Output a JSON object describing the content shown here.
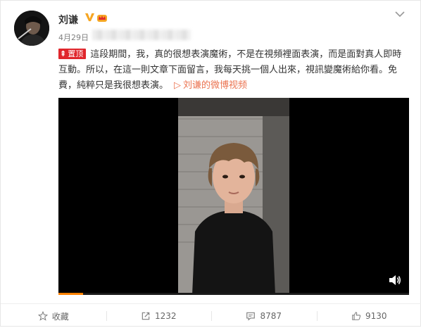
{
  "post": {
    "username": "刘谦",
    "verified_icon": "verified-v-icon",
    "member_icon": "vip-crown-icon",
    "date": "4月29日",
    "pin_label": "置顶",
    "text": "這段期間，我，真的很想表演魔術，不是在視頻裡面表演，而是面對真人即時互動。所以，在這一則文章下面留言，我每天挑一個人出來，視訊變魔術給你看。免費，純粹只是我很想表演。",
    "video_link_label": "刘谦的微博视频"
  },
  "video": {
    "progress_fraction": 0.07,
    "volume_icon": "volume-icon"
  },
  "actions": {
    "favorite_label": "收藏",
    "repost_count": "1232",
    "comment_count": "8787",
    "like_count": "9130"
  },
  "colors": {
    "accent": "#eb7350",
    "pin": "#e0262c",
    "progress": "#ff8200",
    "verified": "#f6a623"
  }
}
